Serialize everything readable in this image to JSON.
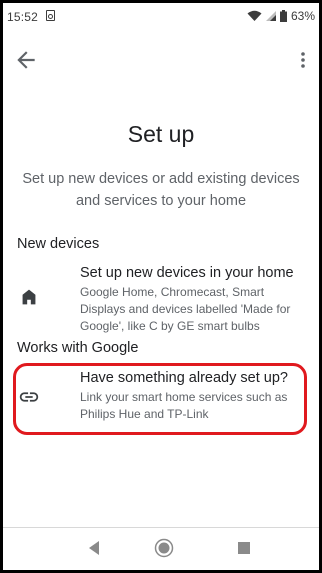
{
  "status_bar": {
    "time": "15:52",
    "battery": "63%"
  },
  "icons": {
    "back": "arrow-back-icon",
    "more": "more-vert-icon",
    "home": "house-icon",
    "link": "link-icon",
    "notification": "media-notification-icon",
    "wifi": "wifi-icon",
    "signal": "cell-signal-icon",
    "battery": "battery-icon"
  },
  "page": {
    "title": "Set up",
    "subtitle": "Set up new devices or add existing devices and services to your home"
  },
  "sections": {
    "new_devices": {
      "header": "New devices",
      "item": {
        "title": "Set up new devices in your home",
        "description": "Google Home, Chromecast, Smart Displays and devices labelled 'Made for Google', like C by GE smart bulbs"
      }
    },
    "works_with_google": {
      "header": "Works with Google",
      "item": {
        "title": "Have something already set up?",
        "description": "Link your smart home services such as Philips Hue and TP-Link"
      }
    }
  },
  "colors": {
    "highlight": "#e0191e",
    "primary_text": "#202124",
    "secondary_text": "#5f6368"
  }
}
